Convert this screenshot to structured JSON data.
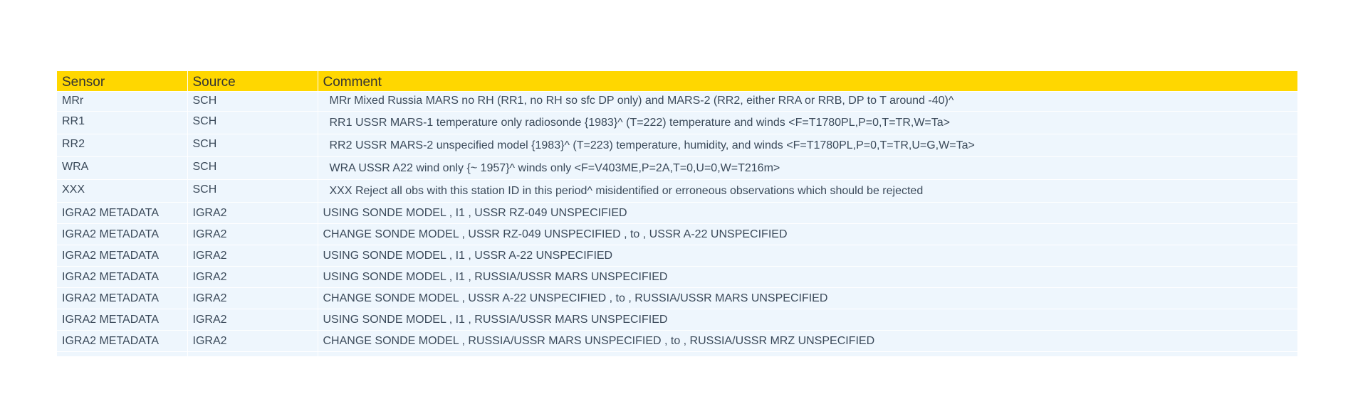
{
  "table": {
    "headers": {
      "sensor": "Sensor",
      "source": "Source",
      "comment": "Comment"
    },
    "rows": [
      {
        "sensor": "MRr",
        "source": "SCH",
        "comment": "MRr Mixed Russia MARS no RH (RR1, no RH so sfc DP only) and MARS-2 (RR2, either RRA or RRB, DP to T around -40)^"
      },
      {
        "sensor": "RR1",
        "source": "SCH",
        "comment": "RR1 USSR MARS-1 temperature only radiosonde {1983}^ (T=222) temperature and winds <F=T1780PL,P=0,T=TR,W=Ta>"
      },
      {
        "sensor": "RR2",
        "source": "SCH",
        "comment": "RR2 USSR MARS-2 unspecified model {1983}^ (T=223) temperature, humidity, and winds <F=T1780PL,P=0,T=TR,U=G,W=Ta>"
      },
      {
        "sensor": "WRA",
        "source": "SCH",
        "comment": "WRA USSR A22 wind only {~ 1957}^ winds only <F=V403ME,P=2A,T=0,U=0,W=T216m>"
      },
      {
        "sensor": "XXX",
        "source": "SCH",
        "comment": "XXX Reject all obs with this station ID in this period^ misidentified or erroneous observations which should be rejected"
      },
      {
        "sensor": "IGRA2 METADATA",
        "source": "IGRA2",
        "comment": "USING SONDE MODEL , I1 , USSR RZ-049 UNSPECIFIED"
      },
      {
        "sensor": "IGRA2 METADATA",
        "source": "IGRA2",
        "comment": "CHANGE SONDE MODEL , USSR RZ-049 UNSPECIFIED , to , USSR A-22 UNSPECIFIED"
      },
      {
        "sensor": "IGRA2 METADATA",
        "source": "IGRA2",
        "comment": "USING SONDE MODEL , I1 , USSR A-22 UNSPECIFIED"
      },
      {
        "sensor": "IGRA2 METADATA",
        "source": "IGRA2",
        "comment": "USING SONDE MODEL , I1 , RUSSIA/USSR MARS UNSPECIFIED"
      },
      {
        "sensor": "IGRA2 METADATA",
        "source": "IGRA2",
        "comment": "CHANGE SONDE MODEL , USSR A-22 UNSPECIFIED , to , RUSSIA/USSR MARS UNSPECIFIED"
      },
      {
        "sensor": "IGRA2 METADATA",
        "source": "IGRA2",
        "comment": "USING SONDE MODEL , I1 , RUSSIA/USSR MARS UNSPECIFIED"
      },
      {
        "sensor": "IGRA2 METADATA",
        "source": "IGRA2",
        "comment": "CHANGE SONDE MODEL , RUSSIA/USSR MARS UNSPECIFIED , to , RUSSIA/USSR MRZ UNSPECIFIED"
      }
    ]
  },
  "colors": {
    "header_bg": "#ffd700",
    "row_bg": "#eef6fd",
    "text": "#3b4a5a"
  }
}
